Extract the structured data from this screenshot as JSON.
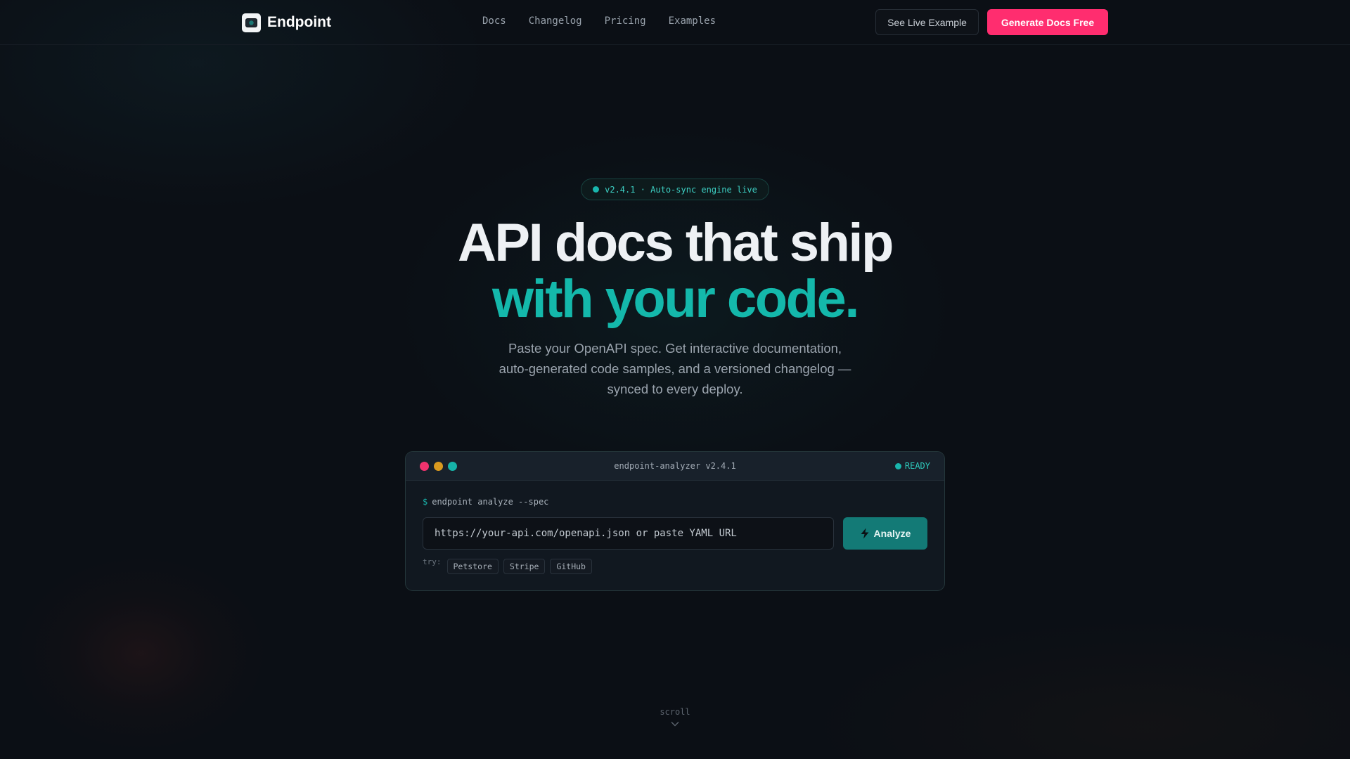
{
  "nav": {
    "brand": "Endpoint",
    "links": [
      "Docs",
      "Changelog",
      "Pricing",
      "Examples"
    ],
    "secondary_button": "See Live Example",
    "primary_button": "Generate Docs Free"
  },
  "hero": {
    "badge": "v2.4.1 · Auto-sync engine live",
    "headline_line1": "API docs that ship",
    "headline_line2": "with your code.",
    "subtitle": "Paste your OpenAPI spec. Get interactive documentation, auto-generated code samples, and a versioned changelog — synced to every deploy."
  },
  "terminal": {
    "title": "endpoint-analyzer v2.4.1",
    "status": "READY",
    "prompt_symbol": "$",
    "command": "endpoint analyze --spec",
    "input_placeholder": "https://your-api.com/openapi.json or paste YAML URL",
    "analyze_button": "Analyze",
    "try_label": "try:",
    "examples": [
      "Petstore",
      "Stripe",
      "GitHub"
    ]
  },
  "scroll_hint": "scroll",
  "colors": {
    "background": "#0b0f15",
    "accent_teal": "#14b8ab",
    "primary_pink": "#ff2d6f",
    "window_red": "#f0336e",
    "window_yellow": "#d99a1f",
    "window_green": "#16b3a8"
  },
  "icons": {
    "brand": "endpoint-logo-icon",
    "analyze": "lightning-bolt-icon",
    "scroll": "chevron-down-icon"
  }
}
